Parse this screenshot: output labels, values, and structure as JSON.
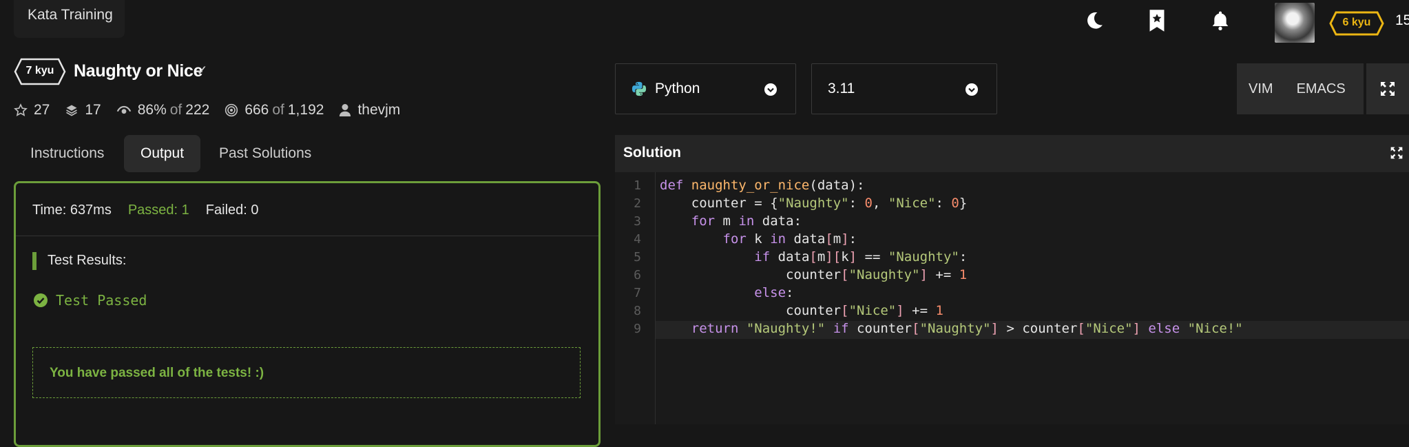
{
  "header": {
    "kata_training_label": "Kata Training",
    "user_rank": "6 kyu",
    "honor": "15"
  },
  "kata": {
    "rank": "7 kyu",
    "title": "Naughty or Nice",
    "stats": {
      "stars": "27",
      "collections": "17",
      "satisfaction_pct": "86%",
      "satisfaction_of": "of",
      "satisfaction_total": "222",
      "completed": "666",
      "completed_of": "of",
      "completed_total": "1,192",
      "author": "thevjm"
    }
  },
  "tabs": {
    "instructions": "Instructions",
    "output": "Output",
    "past_solutions": "Past Solutions"
  },
  "output": {
    "time": "Time: 637ms",
    "passed": "Passed: 1",
    "failed": "Failed: 0",
    "results_label": "Test Results:",
    "test_passed": "Test Passed",
    "all_passed_message": "You have passed all of the tests! :)"
  },
  "editor_controls": {
    "language": "Python",
    "version": "3.11",
    "vim": "VIM",
    "emacs": "EMACS"
  },
  "solution": {
    "label": "Solution",
    "line_numbers": [
      "1",
      "2",
      "3",
      "4",
      "5",
      "6",
      "7",
      "8",
      "9"
    ],
    "code": [
      "def naughty_or_nice(data):",
      "    counter = {\"Naughty\": 0, \"Nice\": 0}",
      "    for m in data:",
      "        for k in data[m]:",
      "            if data[m][k] == \"Naughty\":",
      "                counter[\"Naughty\"] += 1",
      "            else:",
      "                counter[\"Nice\"] += 1",
      "    return \"Naughty!\" if counter[\"Naughty\"] > counter[\"Nice\"] else \"Nice!\""
    ]
  },
  "colors": {
    "success_green": "#7cb342",
    "rank_yellow": "#ecb613",
    "panel_border_green": "#6c9e3a"
  }
}
